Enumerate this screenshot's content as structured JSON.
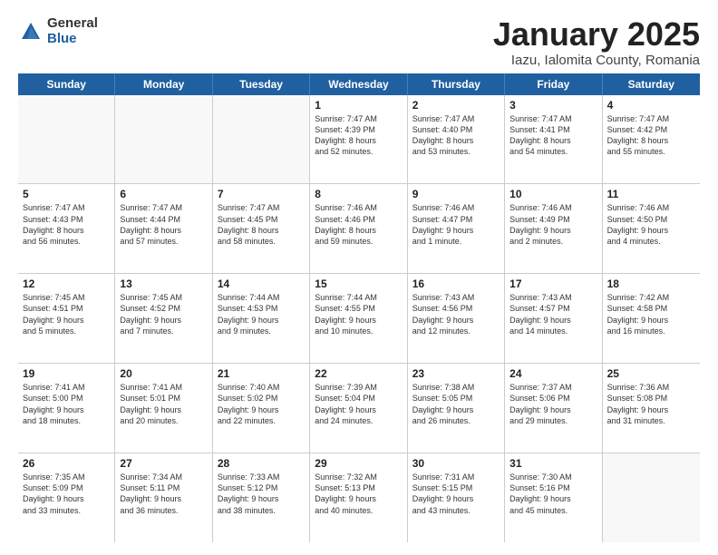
{
  "logo": {
    "general": "General",
    "blue": "Blue"
  },
  "header": {
    "month": "January 2025",
    "location": "Iazu, Ialomita County, Romania"
  },
  "weekdays": [
    "Sunday",
    "Monday",
    "Tuesday",
    "Wednesday",
    "Thursday",
    "Friday",
    "Saturday"
  ],
  "rows": [
    [
      {
        "day": "",
        "text": "",
        "empty": true
      },
      {
        "day": "",
        "text": "",
        "empty": true
      },
      {
        "day": "",
        "text": "",
        "empty": true
      },
      {
        "day": "1",
        "text": "Sunrise: 7:47 AM\nSunset: 4:39 PM\nDaylight: 8 hours\nand 52 minutes."
      },
      {
        "day": "2",
        "text": "Sunrise: 7:47 AM\nSunset: 4:40 PM\nDaylight: 8 hours\nand 53 minutes."
      },
      {
        "day": "3",
        "text": "Sunrise: 7:47 AM\nSunset: 4:41 PM\nDaylight: 8 hours\nand 54 minutes."
      },
      {
        "day": "4",
        "text": "Sunrise: 7:47 AM\nSunset: 4:42 PM\nDaylight: 8 hours\nand 55 minutes."
      }
    ],
    [
      {
        "day": "5",
        "text": "Sunrise: 7:47 AM\nSunset: 4:43 PM\nDaylight: 8 hours\nand 56 minutes."
      },
      {
        "day": "6",
        "text": "Sunrise: 7:47 AM\nSunset: 4:44 PM\nDaylight: 8 hours\nand 57 minutes."
      },
      {
        "day": "7",
        "text": "Sunrise: 7:47 AM\nSunset: 4:45 PM\nDaylight: 8 hours\nand 58 minutes."
      },
      {
        "day": "8",
        "text": "Sunrise: 7:46 AM\nSunset: 4:46 PM\nDaylight: 8 hours\nand 59 minutes."
      },
      {
        "day": "9",
        "text": "Sunrise: 7:46 AM\nSunset: 4:47 PM\nDaylight: 9 hours\nand 1 minute."
      },
      {
        "day": "10",
        "text": "Sunrise: 7:46 AM\nSunset: 4:49 PM\nDaylight: 9 hours\nand 2 minutes."
      },
      {
        "day": "11",
        "text": "Sunrise: 7:46 AM\nSunset: 4:50 PM\nDaylight: 9 hours\nand 4 minutes."
      }
    ],
    [
      {
        "day": "12",
        "text": "Sunrise: 7:45 AM\nSunset: 4:51 PM\nDaylight: 9 hours\nand 5 minutes."
      },
      {
        "day": "13",
        "text": "Sunrise: 7:45 AM\nSunset: 4:52 PM\nDaylight: 9 hours\nand 7 minutes."
      },
      {
        "day": "14",
        "text": "Sunrise: 7:44 AM\nSunset: 4:53 PM\nDaylight: 9 hours\nand 9 minutes."
      },
      {
        "day": "15",
        "text": "Sunrise: 7:44 AM\nSunset: 4:55 PM\nDaylight: 9 hours\nand 10 minutes."
      },
      {
        "day": "16",
        "text": "Sunrise: 7:43 AM\nSunset: 4:56 PM\nDaylight: 9 hours\nand 12 minutes."
      },
      {
        "day": "17",
        "text": "Sunrise: 7:43 AM\nSunset: 4:57 PM\nDaylight: 9 hours\nand 14 minutes."
      },
      {
        "day": "18",
        "text": "Sunrise: 7:42 AM\nSunset: 4:58 PM\nDaylight: 9 hours\nand 16 minutes."
      }
    ],
    [
      {
        "day": "19",
        "text": "Sunrise: 7:41 AM\nSunset: 5:00 PM\nDaylight: 9 hours\nand 18 minutes."
      },
      {
        "day": "20",
        "text": "Sunrise: 7:41 AM\nSunset: 5:01 PM\nDaylight: 9 hours\nand 20 minutes."
      },
      {
        "day": "21",
        "text": "Sunrise: 7:40 AM\nSunset: 5:02 PM\nDaylight: 9 hours\nand 22 minutes."
      },
      {
        "day": "22",
        "text": "Sunrise: 7:39 AM\nSunset: 5:04 PM\nDaylight: 9 hours\nand 24 minutes."
      },
      {
        "day": "23",
        "text": "Sunrise: 7:38 AM\nSunset: 5:05 PM\nDaylight: 9 hours\nand 26 minutes."
      },
      {
        "day": "24",
        "text": "Sunrise: 7:37 AM\nSunset: 5:06 PM\nDaylight: 9 hours\nand 29 minutes."
      },
      {
        "day": "25",
        "text": "Sunrise: 7:36 AM\nSunset: 5:08 PM\nDaylight: 9 hours\nand 31 minutes."
      }
    ],
    [
      {
        "day": "26",
        "text": "Sunrise: 7:35 AM\nSunset: 5:09 PM\nDaylight: 9 hours\nand 33 minutes."
      },
      {
        "day": "27",
        "text": "Sunrise: 7:34 AM\nSunset: 5:11 PM\nDaylight: 9 hours\nand 36 minutes."
      },
      {
        "day": "28",
        "text": "Sunrise: 7:33 AM\nSunset: 5:12 PM\nDaylight: 9 hours\nand 38 minutes."
      },
      {
        "day": "29",
        "text": "Sunrise: 7:32 AM\nSunset: 5:13 PM\nDaylight: 9 hours\nand 40 minutes."
      },
      {
        "day": "30",
        "text": "Sunrise: 7:31 AM\nSunset: 5:15 PM\nDaylight: 9 hours\nand 43 minutes."
      },
      {
        "day": "31",
        "text": "Sunrise: 7:30 AM\nSunset: 5:16 PM\nDaylight: 9 hours\nand 45 minutes."
      },
      {
        "day": "",
        "text": "",
        "empty": true
      }
    ]
  ]
}
